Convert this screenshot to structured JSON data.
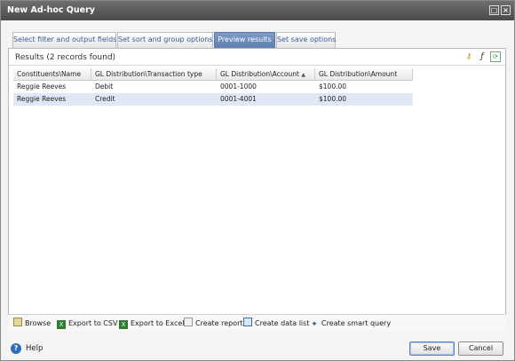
{
  "window": {
    "title": "New Ad-hoc Query"
  },
  "tabs": [
    {
      "label": "Select filter and output fields",
      "active": false
    },
    {
      "label": "Set sort and group options",
      "active": false
    },
    {
      "label": "Preview results",
      "active": true
    },
    {
      "label": "Set save options",
      "active": false
    }
  ],
  "results": {
    "summary": "Results (2 records found)"
  },
  "grid": {
    "columns": [
      "Constituents\\Name",
      "GL Distribution\\Transaction type",
      "GL Distribution\\Account",
      "GL Distribution\\Amount"
    ],
    "sorted_column_index": 2,
    "rows": [
      [
        "Reggie Reeves",
        "Debit",
        "0001-1000",
        "$100.00"
      ],
      [
        "Reggie Reeves",
        "Credit",
        "0001-4001",
        "$100.00"
      ]
    ]
  },
  "toolbar": {
    "items": [
      {
        "label": "Browse",
        "icon": "browse-icon"
      },
      {
        "label": "Export to CSV",
        "icon": "csv-icon"
      },
      {
        "label": "Export to Excel",
        "icon": "excel-icon"
      },
      {
        "label": "Create report",
        "icon": "report-icon"
      },
      {
        "label": "Create data list",
        "icon": "data-list-icon"
      },
      {
        "label": "Create smart query",
        "icon": "smart-query-icon"
      }
    ]
  },
  "footer": {
    "help_label": "Help",
    "save_label": "Save",
    "cancel_label": "Cancel"
  },
  "colors": {
    "titlebar": "#555555",
    "active_tab": "#6b8bbf",
    "selected_row": "#dfe8f4"
  }
}
